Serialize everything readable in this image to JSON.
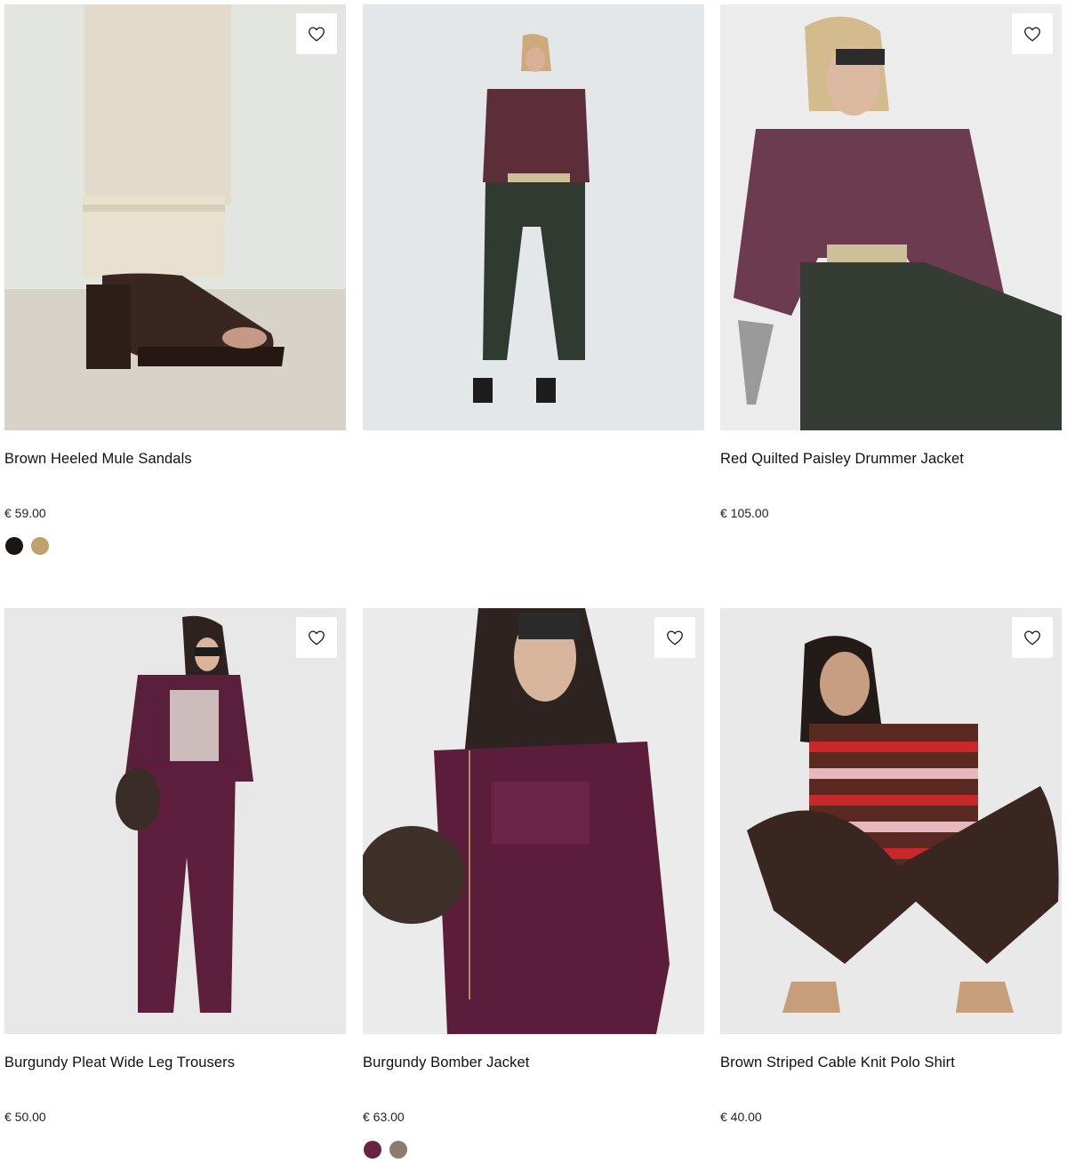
{
  "products": [
    {
      "name": "Brown Heeled Mule Sandals",
      "price": "€ 59.00",
      "wishlist": true,
      "swatches": [
        "#1c1612",
        "#bfa16c"
      ]
    },
    {
      "name": "",
      "price": "",
      "wishlist": false,
      "swatches": []
    },
    {
      "name": "Red Quilted Paisley Drummer Jacket",
      "price": "€ 105.00",
      "wishlist": true,
      "swatches": []
    },
    {
      "name": "Burgundy Pleat Wide Leg Trousers",
      "price": "€ 50.00",
      "wishlist": true,
      "swatches": []
    },
    {
      "name": "Burgundy Bomber Jacket",
      "price": "€ 63.00",
      "wishlist": true,
      "swatches": [
        "#6b2243",
        "#8e7a73"
      ]
    },
    {
      "name": "Brown Striped Cable Knit Polo Shirt",
      "price": "€ 40.00",
      "wishlist": true,
      "swatches": []
    }
  ],
  "icons": {
    "wishlist": "heart-outline-icon"
  }
}
